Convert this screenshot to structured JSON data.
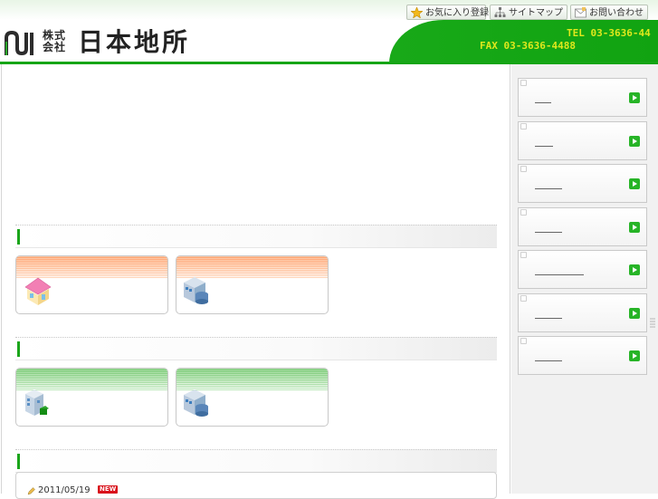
{
  "header": {
    "logo_kaisha": "株式会社",
    "company_name": "日本地所",
    "tel": "TEL 03-3636-44",
    "fax": "FAX 03-3636-4488",
    "top_nav": [
      {
        "label": "お気に入り登録",
        "icon": "star-icon"
      },
      {
        "label": "サイトマップ",
        "icon": "sitemap-icon"
      },
      {
        "label": "お問い合わせ",
        "icon": "mail-icon"
      }
    ]
  },
  "sections": [
    {
      "cards": [
        {
          "icon": "house-icon"
        },
        {
          "icon": "building-icon"
        }
      ],
      "band_color": "#ffc29a"
    },
    {
      "cards": [
        {
          "icon": "office-building-icon"
        },
        {
          "icon": "building-icon"
        }
      ],
      "band_color": "#9edb9a"
    }
  ],
  "news": {
    "items": [
      {
        "date": "2011/05/19",
        "badge": "NEW"
      }
    ]
  },
  "colors": {
    "accent_green": "#16a516",
    "contact_text": "#dfe81c",
    "new_badge": "#d9121c"
  },
  "sidebar": {
    "items": [
      {
        "icon": "arrow-right-icon"
      },
      {
        "icon": "arrow-right-icon"
      },
      {
        "icon": "arrow-right-icon"
      },
      {
        "icon": "arrow-right-icon"
      },
      {
        "icon": "arrow-right-icon"
      },
      {
        "icon": "arrow-right-icon"
      },
      {
        "icon": "arrow-right-icon"
      }
    ]
  }
}
